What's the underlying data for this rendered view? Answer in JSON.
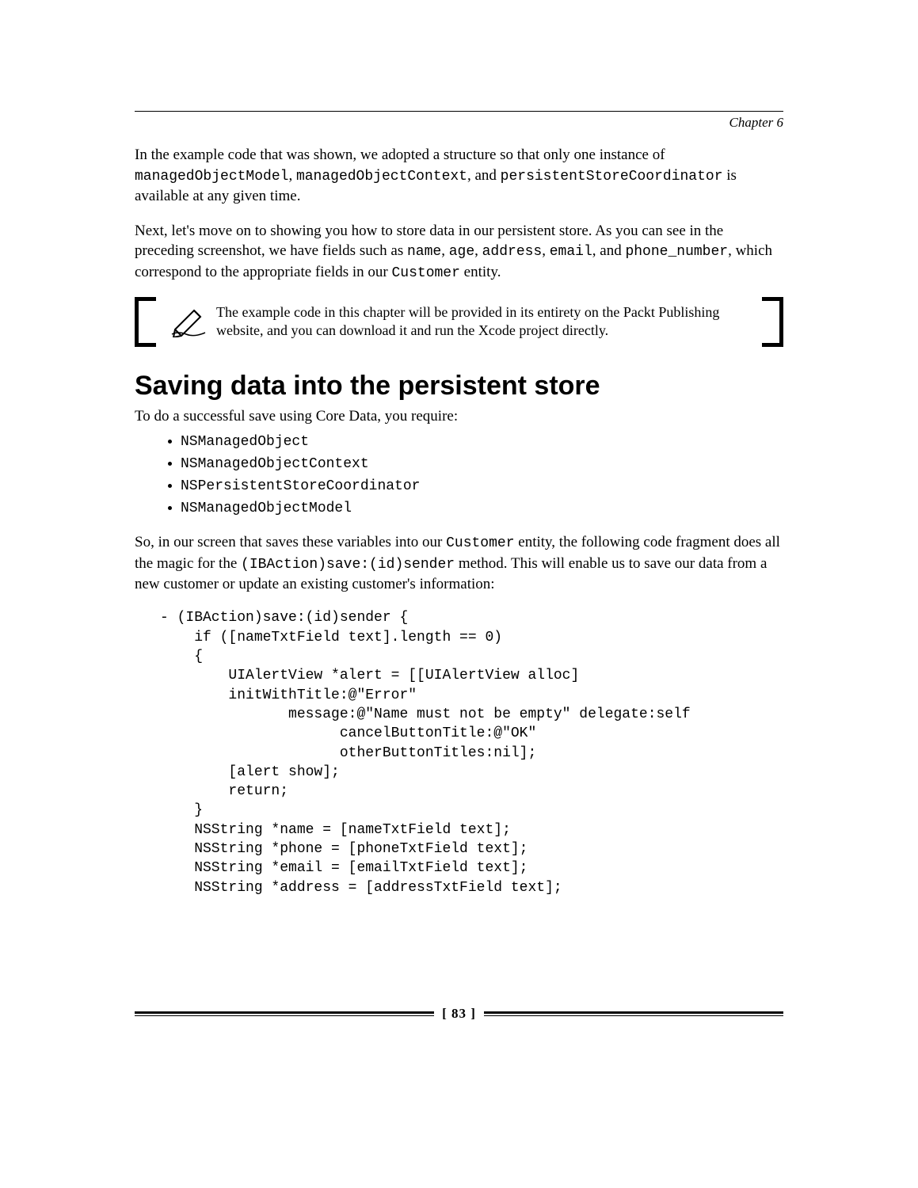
{
  "header": {
    "chapter_label": "Chapter 6"
  },
  "para1": {
    "t1": "In the example code that was shown, we adopted a structure so that only one instance of ",
    "c1": "managedObjectModel",
    "t2": ", ",
    "c2": "managedObjectContext",
    "t3": ", and ",
    "c3": "persistentStoreCoordinator",
    "t4": " is available at any given time."
  },
  "para2": {
    "t1": "Next, let's move on to showing you how to store data in our persistent store. As you can see in the preceding screenshot, we have fields such as ",
    "c1": "name",
    "t2": ", ",
    "c2": "age",
    "t3": ", ",
    "c3": "address",
    "t4": ", ",
    "c4": "email",
    "t5": ", and ",
    "c5": "phone_number",
    "t6": ", which correspond to the appropriate fields in our ",
    "c6": "Customer",
    "t7": " entity."
  },
  "note": {
    "text": "The example code in this chapter will be provided in its entirety on the Packt Publishing website, and you can download it and run the Xcode project directly."
  },
  "section": {
    "heading": "Saving data into the persistent store",
    "intro": "To do a successful save using Core Data, you require:",
    "bullets": [
      "NSManagedObject",
      "NSManagedObjectContext",
      "NSPersistentStoreCoordinator",
      "NSManagedObjectModel"
    ]
  },
  "para3": {
    "t1": "So, in our screen that saves these variables into our ",
    "c1": "Customer",
    "t2": " entity, the following code fragment does all the magic for the ",
    "c2": "(IBAction)save:(id)sender",
    "t3": " method. This will enable us to save our data from a new customer or update an existing customer's information:"
  },
  "code": "- (IBAction)save:(id)sender {\n    if ([nameTxtField text].length == 0)\n    {\n        UIAlertView *alert = [[UIAlertView alloc]\n        initWithTitle:@\"Error\"\n               message:@\"Name must not be empty\" delegate:self\n                     cancelButtonTitle:@\"OK\"\n                     otherButtonTitles:nil];\n        [alert show];\n        return;\n    }\n    NSString *name = [nameTxtField text];\n    NSString *phone = [phoneTxtField text];\n    NSString *email = [emailTxtField text];\n    NSString *address = [addressTxtField text];",
  "footer": {
    "page_number": "[ 83 ]"
  }
}
